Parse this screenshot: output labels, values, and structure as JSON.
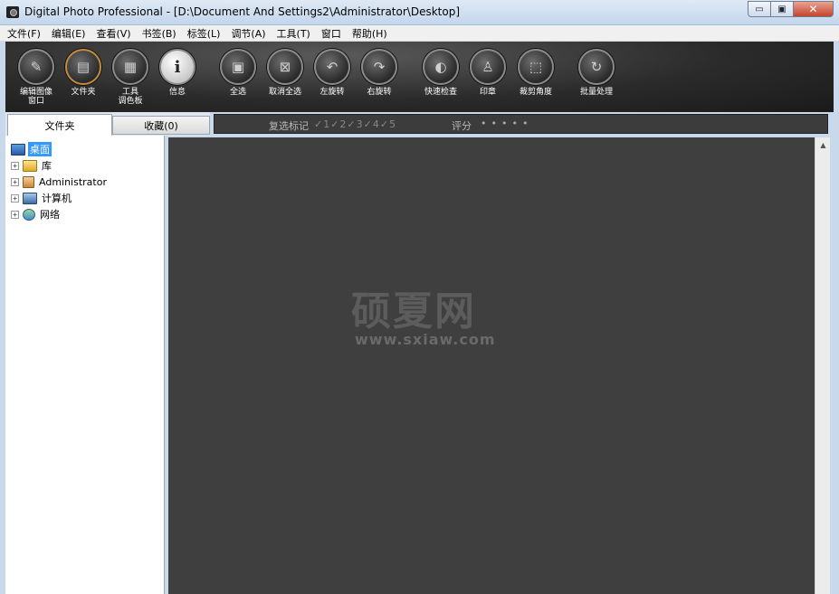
{
  "window": {
    "title": "Digital Photo Professional - [D:\\Document And Settings2\\Administrator\\Desktop]",
    "min_symbol": "▭",
    "max_symbol": "▣",
    "close_symbol": "✕"
  },
  "menu": [
    "文件(F)",
    "编辑(E)",
    "查看(V)",
    "书签(B)",
    "标签(L)",
    "调节(A)",
    "工具(T)",
    "窗口",
    "帮助(H)"
  ],
  "toolbar": {
    "buttons": [
      {
        "label": "编辑图像\n窗口",
        "icon": "edit-image-icon",
        "glyph": "✎"
      },
      {
        "label": "文件夹",
        "icon": "folder-icon",
        "glyph": "▤"
      },
      {
        "label": "工具\n调色板",
        "icon": "tool-palette-icon",
        "glyph": "▦"
      },
      {
        "label": "信息",
        "icon": "info-icon",
        "glyph": "i"
      },
      {
        "label": "全选",
        "icon": "select-all-icon",
        "glyph": "▣"
      },
      {
        "label": "取消全选",
        "icon": "deselect-all-icon",
        "glyph": "⊠"
      },
      {
        "label": "左旋转",
        "icon": "rotate-left-icon",
        "glyph": "↶"
      },
      {
        "label": "右旋转",
        "icon": "rotate-right-icon",
        "glyph": "↷"
      },
      {
        "label": "快速检查",
        "icon": "quick-check-icon",
        "glyph": "◐"
      },
      {
        "label": "印章",
        "icon": "stamp-icon",
        "glyph": "♙"
      },
      {
        "label": "裁剪角度",
        "icon": "crop-angle-icon",
        "glyph": "⬚"
      },
      {
        "label": "批量处理",
        "icon": "batch-process-icon",
        "glyph": "↻"
      }
    ]
  },
  "tabs": {
    "folder": "文件夹",
    "favorites": "收藏(0)"
  },
  "tree": [
    {
      "label": "桌面",
      "icon": "desktop-icon",
      "expander": "",
      "selected": true
    },
    {
      "label": "库",
      "icon": "library-icon",
      "expander": "+"
    },
    {
      "label": "Administrator",
      "icon": "user-folder-icon",
      "expander": "+"
    },
    {
      "label": "计算机",
      "icon": "computer-icon",
      "expander": "+"
    },
    {
      "label": "网络",
      "icon": "network-icon",
      "expander": "+"
    }
  ],
  "filter": {
    "check_label": "复选标记",
    "check_marks": "✓1✓2✓3✓4✓5",
    "rating_label": "评分",
    "rating_dots": "•••••"
  },
  "watermark": {
    "main": "硕夏网",
    "sub": "www.sxiaw.com"
  },
  "scrollbar": {
    "up_arrow": "▲"
  },
  "colors": {
    "accent_selected": "#3399ff",
    "viewer_bg": "#3f3f3f",
    "toolbar_bg": "#2b2b2b"
  }
}
